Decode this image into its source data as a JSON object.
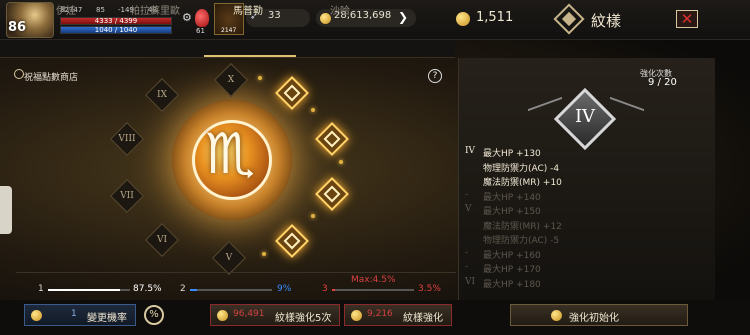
{
  "player": {
    "level": "86",
    "stat_a": "82747",
    "stat_b": "85",
    "stat_c": "-149",
    "stat_d": "48",
    "hp": "4333 / 4399",
    "mp": "1040 / 1040",
    "potion_count": "61",
    "slot_count": "2147"
  },
  "currency": {
    "wing_amount": "33",
    "gold": "28,613,698",
    "special_gold": "1,511"
  },
  "header": {
    "title": "紋樣"
  },
  "tabs": [
    {
      "label": "伊娃"
    },
    {
      "label": "帕拉蘇里歐"
    },
    {
      "label": "馬普勒"
    },
    {
      "label": "沙哈"
    }
  ],
  "left": {
    "shop_label": "祝福點數商店",
    "help": "?",
    "nodes": [
      "X",
      "IX",
      "VIII",
      "VII",
      "VI",
      "V"
    ]
  },
  "sliders": [
    {
      "label": "1",
      "value": "87.5%",
      "fill": 0.875,
      "color": "#ffffff"
    },
    {
      "label": "2",
      "value": "9%",
      "fill": 0.09,
      "color": "#3a8cff"
    },
    {
      "label": "3",
      "value": "3.5%",
      "fill": 0.035,
      "color": "#e04040"
    }
  ],
  "max_note": "Max:4.5%",
  "right": {
    "count_label": "強化次數",
    "count_value": "9 / 20",
    "badge": "IV",
    "stats": [
      {
        "tier": "IV",
        "text": "最大HP +130",
        "active": true
      },
      {
        "tier": "",
        "text": "物理防禦力(AC) -4",
        "active": true
      },
      {
        "tier": "",
        "text": "魔法防禦(MR) +10",
        "active": true
      },
      {
        "tier": "-",
        "text": "最大HP +140",
        "active": false
      },
      {
        "tier": "V",
        "text": "最大HP +150",
        "active": false
      },
      {
        "tier": "",
        "text": "魔法防禦(MR) +12",
        "active": false
      },
      {
        "tier": "",
        "text": "物理防禦力(AC) -5",
        "active": false
      },
      {
        "tier": "-",
        "text": "最大HP +160",
        "active": false
      },
      {
        "tier": "-",
        "text": "最大HP +170",
        "active": false
      },
      {
        "tier": "VI",
        "text": "最大HP +180",
        "active": false
      }
    ]
  },
  "bottom": {
    "change_rate_count": "1",
    "change_rate_label": "變更機率",
    "pct_icon": "%",
    "strengthen5_cost": "96,491",
    "strengthen5_label": "紋樣強化5次",
    "strengthen_cost": "9,216",
    "strengthen_label": "紋樣強化",
    "reset_label": "強化初始化"
  }
}
